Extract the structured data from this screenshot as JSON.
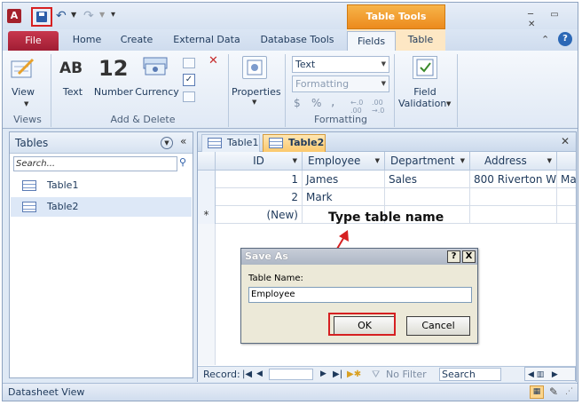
{
  "app": {
    "logo_letter": "A"
  },
  "title": {
    "context_tab": "Table Tools"
  },
  "tabs": [
    "File",
    "Home",
    "Create",
    "External Data",
    "Database Tools",
    "Fields",
    "Table"
  ],
  "ribbon": {
    "views": {
      "view_label": "View",
      "group": "Views"
    },
    "add_delete": {
      "text_label": "Text",
      "text_icon": "AB",
      "number_label": "Number",
      "number_icon": "12",
      "currency_label": "Currency",
      "group": "Add & Delete"
    },
    "properties": {
      "label": "Properties"
    },
    "formatting": {
      "type_value": "Text",
      "format_value": "Formatting",
      "dollar": "$",
      "percent": "%",
      "comma": ",",
      "group": "Formatting"
    },
    "field_validation": {
      "label_line1": "Field",
      "label_line2": "Validation"
    }
  },
  "nav": {
    "title": "Tables",
    "search_placeholder": "Search...",
    "items": [
      {
        "label": "Table1"
      },
      {
        "label": "Table2"
      }
    ]
  },
  "doc_tabs": [
    {
      "label": "Table1"
    },
    {
      "label": "Table2"
    }
  ],
  "grid": {
    "columns": [
      "ID",
      "Employee",
      "Department",
      "Address"
    ],
    "rows": [
      {
        "id": "1",
        "employee": "James",
        "department": "Sales",
        "address": "800 Riverton W",
        "overflow": "Ma"
      },
      {
        "id": "2",
        "employee": "Mark",
        "department": "",
        "address": ""
      }
    ],
    "new_row_marker": "*",
    "new_row_id": "(New)"
  },
  "record_bar": {
    "record_label": "Record:",
    "filter": "No Filter",
    "search": "Search"
  },
  "status": {
    "text": "Datasheet View"
  },
  "dialog": {
    "title": "Save As",
    "help_btn": "?",
    "close_btn": "X",
    "field_label": "Table Name:",
    "field_value": "Employee",
    "ok": "OK",
    "cancel": "Cancel"
  },
  "annotation": {
    "text": "Type table name"
  },
  "colors": {
    "file_tab": "#b12a3f",
    "context_tab": "#f19a2b",
    "highlight": "#d62021"
  }
}
